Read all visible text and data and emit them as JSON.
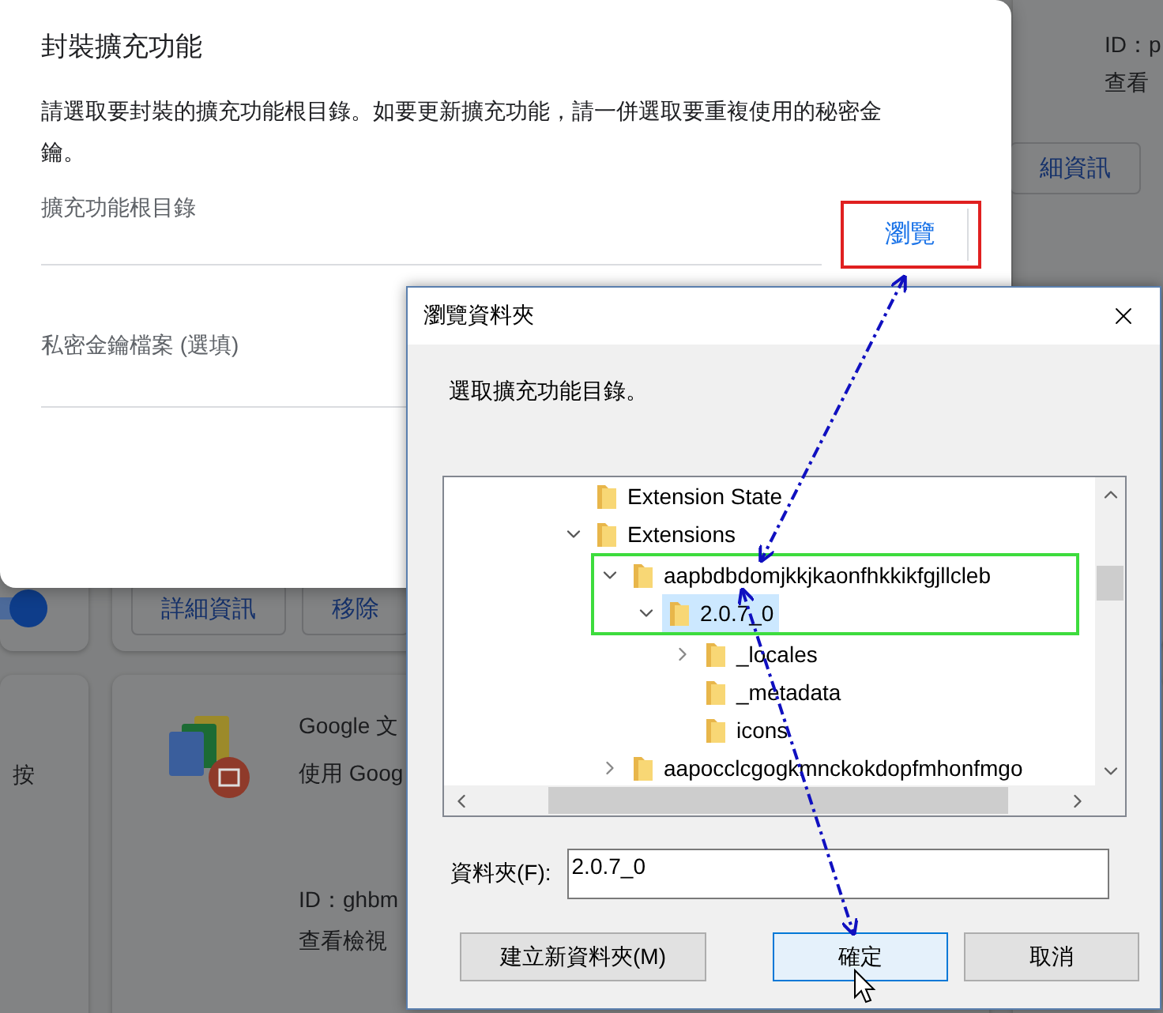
{
  "background": {
    "top_card": {
      "id": "ID：p",
      "link": "查看",
      "buttons": [
        "細資訊"
      ]
    },
    "first_card": {
      "toggle_on": true
    },
    "second_card": {
      "buttons": [
        "詳細資訊",
        "移除"
      ]
    },
    "left_card": {
      "text": "按"
    },
    "google_card": {
      "title": "Google 文",
      "description": "使用 Goog",
      "id": "ID：ghbm",
      "link": "查看檢視"
    }
  },
  "pack_dialog": {
    "title": "封裝擴充功能",
    "description": "請選取要封裝的擴充功能根目錄。如要更新擴充功能，請一併選取要重複使用的秘密金鑰。",
    "root_label": "擴充功能根目錄",
    "browse_button": {
      "label": "瀏覽",
      "highlighted": true
    },
    "key_label": "私密金鑰檔案 (選填)"
  },
  "browse_dialog": {
    "title": "瀏覽資料夾",
    "prompt": "選取擴充功能目錄。",
    "tree": [
      {
        "label": "Extension State",
        "expandable": false,
        "selected": false,
        "highlighted": false
      },
      {
        "label": "Extensions",
        "expandable": true,
        "expanded": true,
        "selected": false,
        "highlighted": false,
        "children": [
          {
            "label": "aapbdbdomjkkjkaonfhkkikfgjllcleb",
            "expandable": true,
            "expanded": true,
            "selected": false,
            "highlighted": true,
            "children": [
              {
                "label": "2.0.7_0",
                "expandable": true,
                "expanded": true,
                "selected": true,
                "highlighted": true,
                "children": [
                  {
                    "label": "_locales",
                    "expandable": true,
                    "expanded": false,
                    "selected": false,
                    "highlighted": false
                  },
                  {
                    "label": "_metadata",
                    "expandable": false,
                    "selected": false,
                    "highlighted": false
                  },
                  {
                    "label": "icons",
                    "expandable": false,
                    "selected": false,
                    "highlighted": false
                  }
                ]
              }
            ]
          },
          {
            "label": "aapocclcgogkmnckokdopfmhonfmgo",
            "expandable": true,
            "expanded": false,
            "selected": false,
            "highlighted": false
          }
        ]
      }
    ],
    "folder_label": "資料夾(F):",
    "folder_value": "2.0.7_0",
    "buttons": [
      {
        "label": "建立新資料夾(M)",
        "default": false
      },
      {
        "label": "確定",
        "default": true
      },
      {
        "label": "取消",
        "default": false
      }
    ]
  },
  "annotations": {
    "arrows": [
      {
        "kind": "double-headed"
      },
      {
        "kind": "double-headed"
      }
    ]
  }
}
